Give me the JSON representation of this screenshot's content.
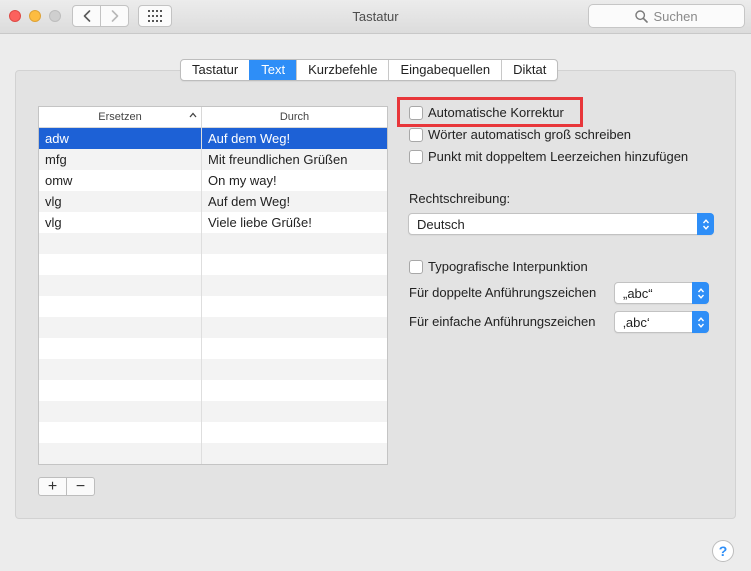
{
  "window": {
    "title": "Tastatur",
    "search_placeholder": "Suchen"
  },
  "tabs": [
    {
      "label": "Tastatur",
      "active": false
    },
    {
      "label": "Text",
      "active": true
    },
    {
      "label": "Kurzbefehle",
      "active": false
    },
    {
      "label": "Eingabequellen",
      "active": false
    },
    {
      "label": "Diktat",
      "active": false
    }
  ],
  "table": {
    "columns": [
      "Ersetzen",
      "Durch"
    ],
    "rows": [
      {
        "replace": "adw",
        "with": "Auf dem Weg!",
        "selected": true
      },
      {
        "replace": "mfg",
        "with": "Mit freundlichen Grüßen",
        "selected": false
      },
      {
        "replace": "omw",
        "with": "On my way!",
        "selected": false
      },
      {
        "replace": "vlg",
        "with": "Auf dem Weg!",
        "selected": false
      },
      {
        "replace": "vlg",
        "with": "Viele liebe Grüße!",
        "selected": false
      }
    ],
    "add_label": "+",
    "remove_label": "−"
  },
  "options": {
    "auto_correct": {
      "label": "Automatische Korrektur",
      "checked": false
    },
    "auto_capitalize": {
      "label": "Wörter automatisch groß schreiben",
      "checked": false
    },
    "double_space_period": {
      "label": "Punkt mit doppeltem Leerzeichen hinzufügen",
      "checked": false
    },
    "spelling_label": "Rechtschreibung:",
    "spelling_value": "Deutsch",
    "smart_quotes": {
      "label": "Typografische Interpunktion",
      "checked": false
    },
    "double_quotes_label": "Für doppelte Anführungszeichen",
    "double_quotes_value": "„abc“",
    "single_quotes_label": "Für einfache Anführungszeichen",
    "single_quotes_value": "‚abc‘"
  },
  "help_label": "?",
  "colors": {
    "accent": "#2e8ef7",
    "selection": "#1d61d6",
    "highlight": "#e8363a"
  }
}
